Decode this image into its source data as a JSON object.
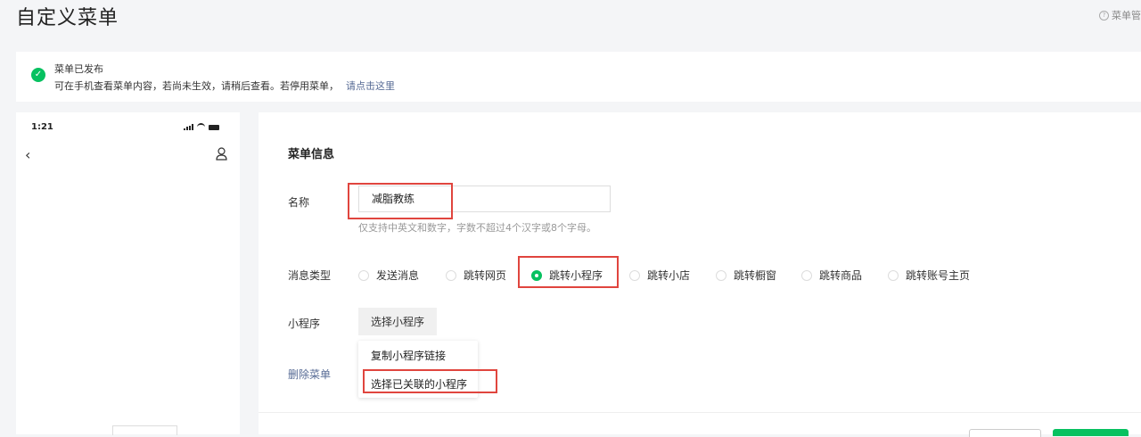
{
  "page": {
    "title": "自定义菜单",
    "help_text": "菜单管"
  },
  "notice": {
    "title": "菜单已发布",
    "desc": "可在手机查看菜单内容，若尚未生效，请稍后查看。若停用菜单，",
    "link": "请点击这里"
  },
  "phone": {
    "time": "1:21"
  },
  "form": {
    "section_title": "菜单信息",
    "name_label": "名称",
    "name_value": "减脂教练",
    "name_hint": "仅支持中英文和数字，字数不超过4个汉字或8个字母。",
    "type_label": "消息类型",
    "types": [
      {
        "label": "发送消息",
        "selected": false
      },
      {
        "label": "跳转网页",
        "selected": false
      },
      {
        "label": "跳转小程序",
        "selected": true
      },
      {
        "label": "跳转小店",
        "selected": false
      },
      {
        "label": "跳转橱窗",
        "selected": false
      },
      {
        "label": "跳转商品",
        "selected": false
      },
      {
        "label": "跳转账号主页",
        "selected": false
      }
    ],
    "miniprogram_label": "小程序",
    "select_button": "选择小程序",
    "dropdown": [
      "复制小程序链接",
      "选择已关联的小程序"
    ],
    "delete_link": "删除菜单"
  },
  "colors": {
    "accent": "#07c160",
    "link": "#576b95",
    "highlight": "#e0453e"
  }
}
